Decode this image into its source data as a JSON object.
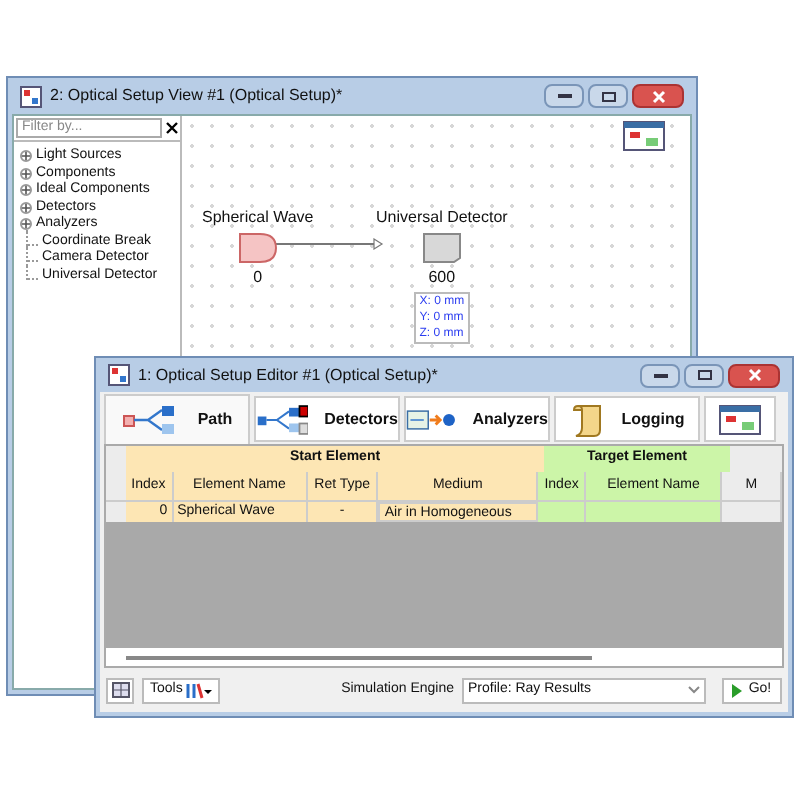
{
  "setup_view": {
    "title": "2: Optical Setup View #1 (Optical Setup)*",
    "filter": {
      "placeholder": "Filter by..."
    },
    "tree": [
      {
        "kind": "group",
        "label": "Light Sources",
        "expanded": false
      },
      {
        "kind": "group",
        "label": "Components",
        "expanded": false
      },
      {
        "kind": "group",
        "label": "Ideal Components",
        "expanded": false
      },
      {
        "kind": "group",
        "label": "Detectors",
        "expanded": false
      },
      {
        "kind": "group",
        "label": "Analyzers",
        "expanded": false
      },
      {
        "kind": "leaf",
        "label": "Coordinate Break"
      },
      {
        "kind": "leaf",
        "label": "Camera Detector"
      },
      {
        "kind": "leaf",
        "label": "Universal Detector"
      }
    ],
    "nodes": [
      {
        "kind": "source",
        "name": "Spherical Wave",
        "index": "0"
      },
      {
        "kind": "detector",
        "name": "Universal Detector",
        "index": "600",
        "position": [
          "X: 0 mm",
          "Y: 0 mm",
          "Z: 0 mm"
        ]
      }
    ]
  },
  "editor": {
    "title": "1: Optical Setup Editor #1 (Optical Setup)*",
    "tabs": [
      {
        "kind": "path",
        "label": "Path",
        "selected": true
      },
      {
        "kind": "detectors",
        "label": "Detectors",
        "selected": false
      },
      {
        "kind": "analyzers",
        "label": "Analyzers",
        "selected": false
      },
      {
        "kind": "logging",
        "label": "Logging",
        "selected": false
      },
      {
        "kind": "settings",
        "selected": false
      }
    ],
    "groups": [
      {
        "kind": "start",
        "label": "Start Element"
      },
      {
        "kind": "target",
        "label": "Target Element"
      }
    ],
    "columns": [
      {
        "kind": "start",
        "label": "Index"
      },
      {
        "kind": "start",
        "label": "Element Name"
      },
      {
        "kind": "start",
        "label": "Ret Type"
      },
      {
        "kind": "start",
        "label": "Medium"
      },
      {
        "kind": "target",
        "label": "Index"
      },
      {
        "kind": "target",
        "label": "Element Name"
      },
      {
        "kind": "other",
        "label": "M"
      }
    ],
    "rows": [
      [
        "0",
        "Spherical Wave",
        "-",
        "Air in Homogeneous",
        "",
        ""
      ]
    ],
    "tools": "Tools",
    "engine_label": "Simulation Engine",
    "engine": "Profile: Ray Results",
    "go": "Go!"
  }
}
